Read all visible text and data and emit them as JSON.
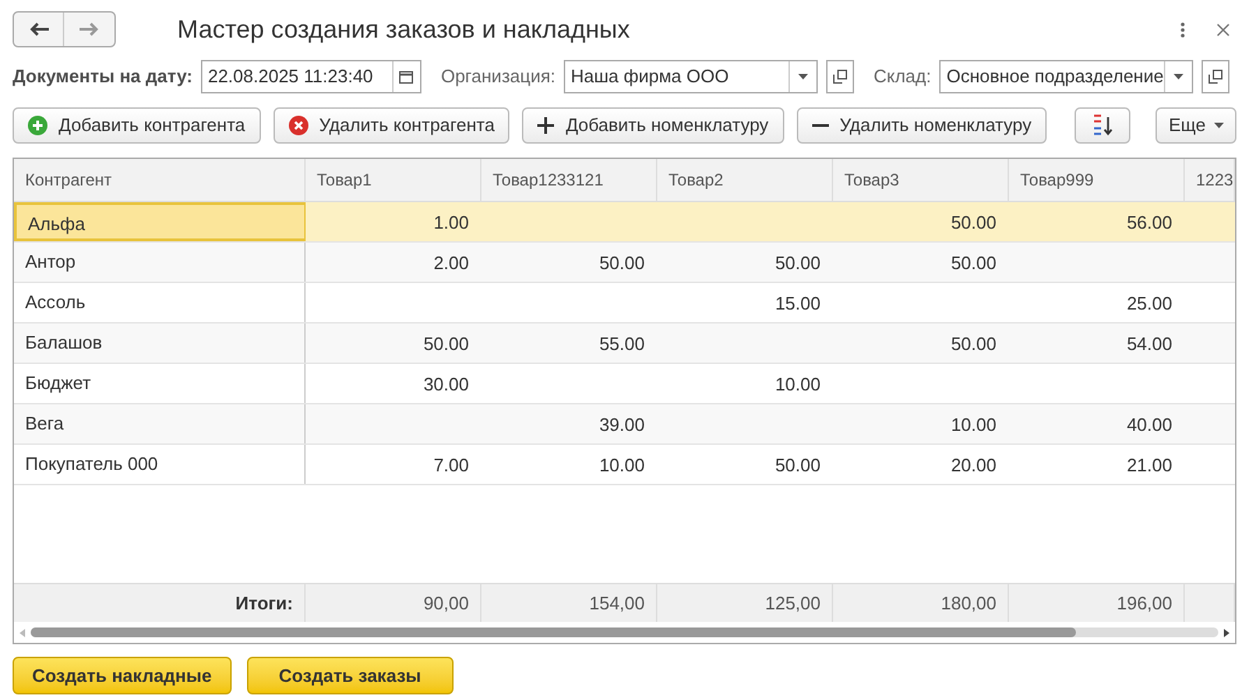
{
  "window": {
    "title": "Мастер создания заказов и накладных"
  },
  "filters": [
    {
      "label": "Документы на дату:",
      "value": "22.08.2025 11:23:40",
      "kind": "date"
    },
    {
      "label": "Организация:",
      "value": "Наша фирма ООО",
      "kind": "select"
    },
    {
      "label": "Склад:",
      "value": "Основное подразделение",
      "kind": "select"
    }
  ],
  "toolbar": [
    {
      "label": "Добавить контрагента",
      "kind": "add"
    },
    {
      "label": "Удалить контрагента",
      "kind": "delete"
    },
    {
      "label": "Добавить номенклатуру",
      "kind": "plus"
    },
    {
      "label": "Удалить номенклатуру",
      "kind": "minus"
    }
  ],
  "more_button": "Еще",
  "table": {
    "columns": [
      "Контрагент",
      "Товар1",
      "Товар1233121",
      "Товар2",
      "Товар3",
      "Товар999",
      "1223"
    ],
    "rows": [
      {
        "name": "Альфа",
        "selected": true,
        "column_1": "1.00",
        "column_4": "50.00",
        "column_5": "56.00"
      },
      {
        "name": "Антор",
        "selected": false,
        "column_1": "2.00",
        "column_2": "50.00",
        "column_3": "50.00",
        "column_4": "50.00"
      },
      {
        "name": "Ассоль",
        "selected": false,
        "column_3": "15.00",
        "column_5": "25.00"
      },
      {
        "name": "Балашов",
        "selected": false,
        "column_1": "50.00",
        "column_2": "55.00",
        "column_4": "50.00",
        "column_5": "54.00"
      },
      {
        "name": "Бюджет",
        "selected": false,
        "column_1": "30.00",
        "column_3": "10.00"
      },
      {
        "name": "Вега",
        "selected": false,
        "column_2": "39.00",
        "column_4": "10.00",
        "column_5": "40.00"
      },
      {
        "name": "Покупатель 000",
        "selected": false,
        "column_1": "7.00",
        "column_2": "10.00",
        "column_3": "50.00",
        "column_4": "20.00",
        "column_5": "21.00"
      }
    ],
    "totals": {
      "label": "Итоги:",
      "column_1": "90,00",
      "column_2": "154,00",
      "column_3": "125,00",
      "column_4": "180,00",
      "column_5": "196,00"
    }
  },
  "actions": [
    "Создать накладные",
    "Создать заказы"
  ]
}
